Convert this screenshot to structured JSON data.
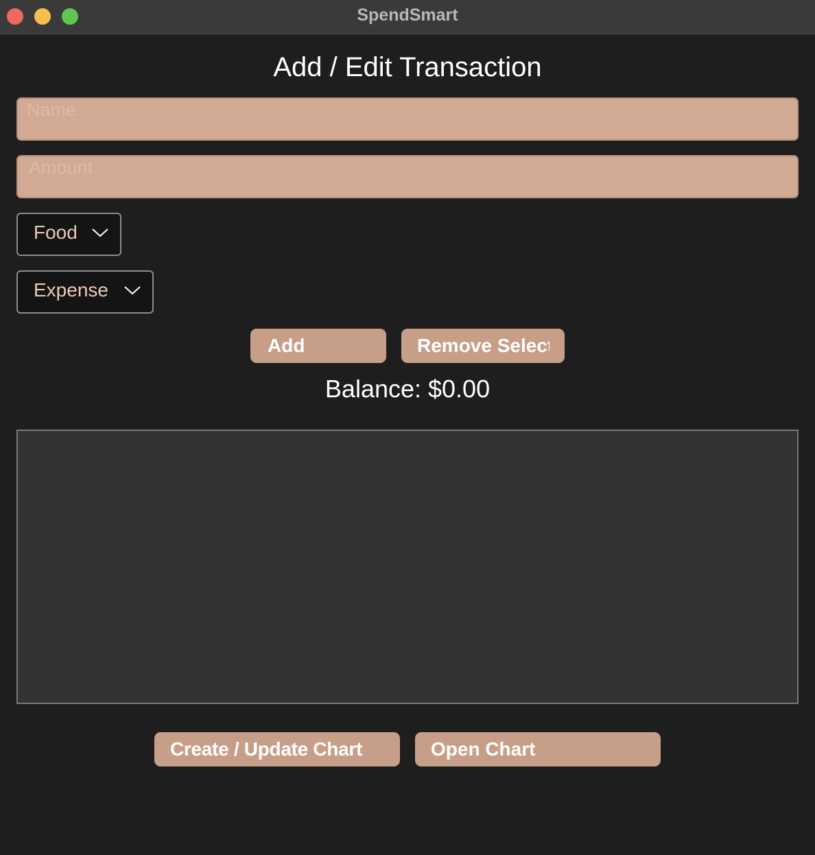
{
  "window": {
    "title": "SpendSmart"
  },
  "form": {
    "heading": "Add / Edit Transaction",
    "name_placeholder": "Name",
    "amount_placeholder": "Amount",
    "category_selected": "Food",
    "type_selected": "Expense",
    "add_label": "Add",
    "remove_label": "Remove Selected"
  },
  "summary": {
    "balance_text": "Balance: $0.00"
  },
  "transactions": [],
  "chart_actions": {
    "create_label": "Create / Update Chart",
    "open_label": "Open Chart"
  },
  "colors": {
    "window_background": "#1e1e1f",
    "titlebar": "#3b3a3a",
    "accent_button": "#c79f88",
    "input_fill": "#d2a992",
    "dropdown_text": "#ecc8b4",
    "list_background": "#333333"
  },
  "icons": {
    "dropdown_chevron": "chevron-down-icon"
  }
}
